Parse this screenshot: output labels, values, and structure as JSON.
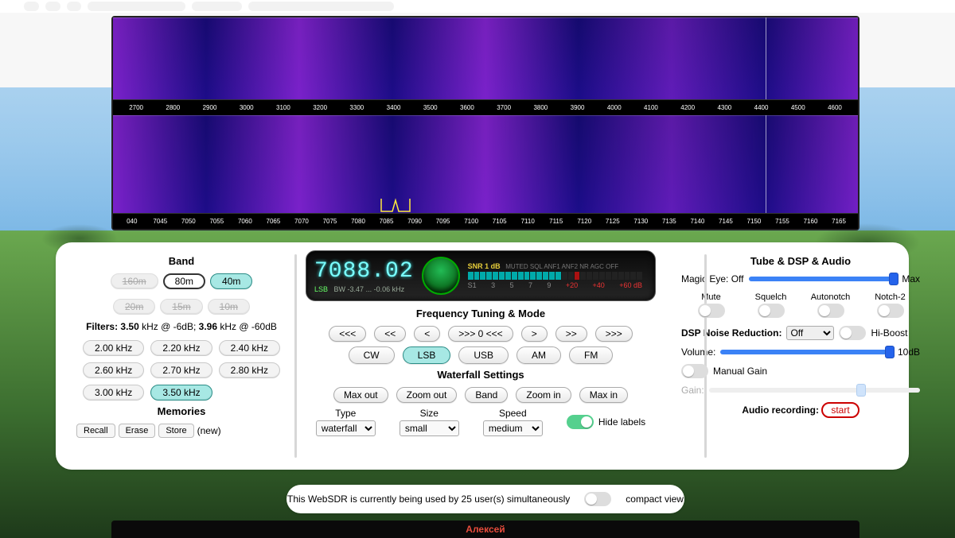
{
  "waterfall": {
    "upper_ticks": [
      "2700",
      "2800",
      "2900",
      "3000",
      "3100",
      "3200",
      "3300",
      "3400",
      "3500",
      "3600",
      "3700",
      "3800",
      "3900",
      "4000",
      "4100",
      "4200",
      "4300",
      "4400",
      "4500",
      "4600"
    ],
    "lower_ticks": [
      "040",
      "7045",
      "7050",
      "7055",
      "7060",
      "7065",
      "7070",
      "7075",
      "7080",
      "7085",
      "7090",
      "7095",
      "7100",
      "7105",
      "7110",
      "7115",
      "7120",
      "7125",
      "7130",
      "7135",
      "7140",
      "7145",
      "7150",
      "7155",
      "7160",
      "7165"
    ]
  },
  "band": {
    "title": "Band",
    "buttons": [
      "160m",
      "80m",
      "40m",
      "20m",
      "15m",
      "10m"
    ],
    "active": "40m",
    "ringed": "80m",
    "disabled": [
      "160m",
      "20m",
      "15m",
      "10m"
    ]
  },
  "filters": {
    "label": "Filters:",
    "bw6_val": "3.50",
    "bw6_unit": "kHz @ -6dB;",
    "bw60_val": "3.96",
    "bw60_unit": "kHz @ -60dB",
    "buttons": [
      "2.00 kHz",
      "2.20 kHz",
      "2.40 kHz",
      "2.60 kHz",
      "2.70 kHz",
      "2.80 kHz",
      "3.00 kHz",
      "3.50 kHz"
    ],
    "selected": "3.50 kHz"
  },
  "memories": {
    "title": "Memories",
    "recall": "Recall",
    "erase": "Erase",
    "store": "Store",
    "new": "(new)"
  },
  "lcd": {
    "freq": "7088.02",
    "mode": "LSB",
    "bw_label": "BW",
    "bw_lo": "-3.47",
    "dots": "...",
    "bw_hi": "-0.06",
    "unit": "kHz",
    "snr_label": "SNR",
    "snr_val": "1 dB",
    "flags": "MUTED  SQL  ANF1  ANF2  NR  AGC OFF",
    "smeter": [
      "S1",
      "3",
      "5",
      "7",
      "9",
      "+20",
      "+40",
      "+60 dB"
    ]
  },
  "tuning": {
    "title": "Frequency Tuning & Mode",
    "nav": [
      "<<<",
      "<<",
      "<",
      ">>> 0 <<<",
      ">",
      ">>",
      ">>>"
    ],
    "modes": [
      "CW",
      "LSB",
      "USB",
      "AM",
      "FM"
    ],
    "mode_selected": "LSB"
  },
  "wfset": {
    "title": "Waterfall Settings",
    "buttons": [
      "Max out",
      "Zoom out",
      "Band",
      "Zoom in",
      "Max in"
    ],
    "type_label": "Type",
    "type_val": "waterfall",
    "size_label": "Size",
    "size_val": "small",
    "speed_label": "Speed",
    "speed_val": "medium",
    "hide_labels": "Hide labels"
  },
  "audio": {
    "title": "Tube & DSP & Audio",
    "magic_label": "Magic Eye:",
    "magic_off": "Off",
    "magic_max": "Max",
    "mute": "Mute",
    "squelch": "Squelch",
    "autonotch": "Autonotch",
    "notch2": "Notch-2",
    "dspnr_label": "DSP Noise Reduction:",
    "dspnr_val": "Off",
    "hiboost": "Hi-Boost",
    "volume_label": "Volume:",
    "volume_val": "10dB",
    "manual_gain": "Manual Gain",
    "gain_label": "Gain:",
    "rec_label": "Audio recording:",
    "rec_btn": "start"
  },
  "footer": {
    "text": "This WebSDR is currently being used by 25 user(s) simultaneously",
    "compact": "compact view"
  },
  "username": "Алексей"
}
